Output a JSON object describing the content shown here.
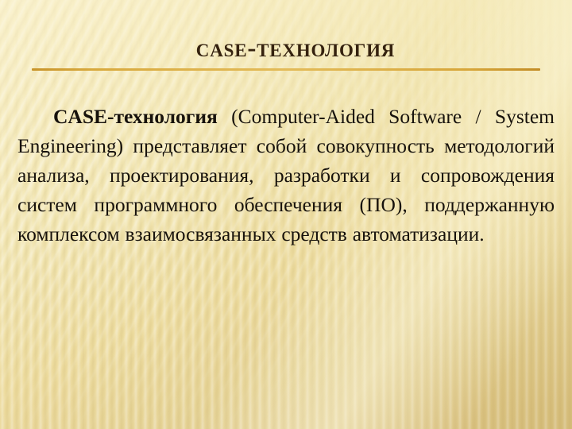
{
  "slide": {
    "title": "CASE-технология",
    "rule_color": "#d8a93d",
    "title_color": "#35220f",
    "body_color": "#17120c",
    "background_colors": {
      "light": "#faf2cd",
      "mid": "#f3e7b3",
      "dark": "#d9c283"
    },
    "body": {
      "lead": "CASE-технология",
      "rest": " (Computer-Aided  Software / System  Engineering)  представляет  собой совокупность методологий анализа, проектирования, разработки и сопровождения систем программного обеспечения (ПО), поддержанную комплексом взаимосвязанных средств автоматизации."
    }
  }
}
